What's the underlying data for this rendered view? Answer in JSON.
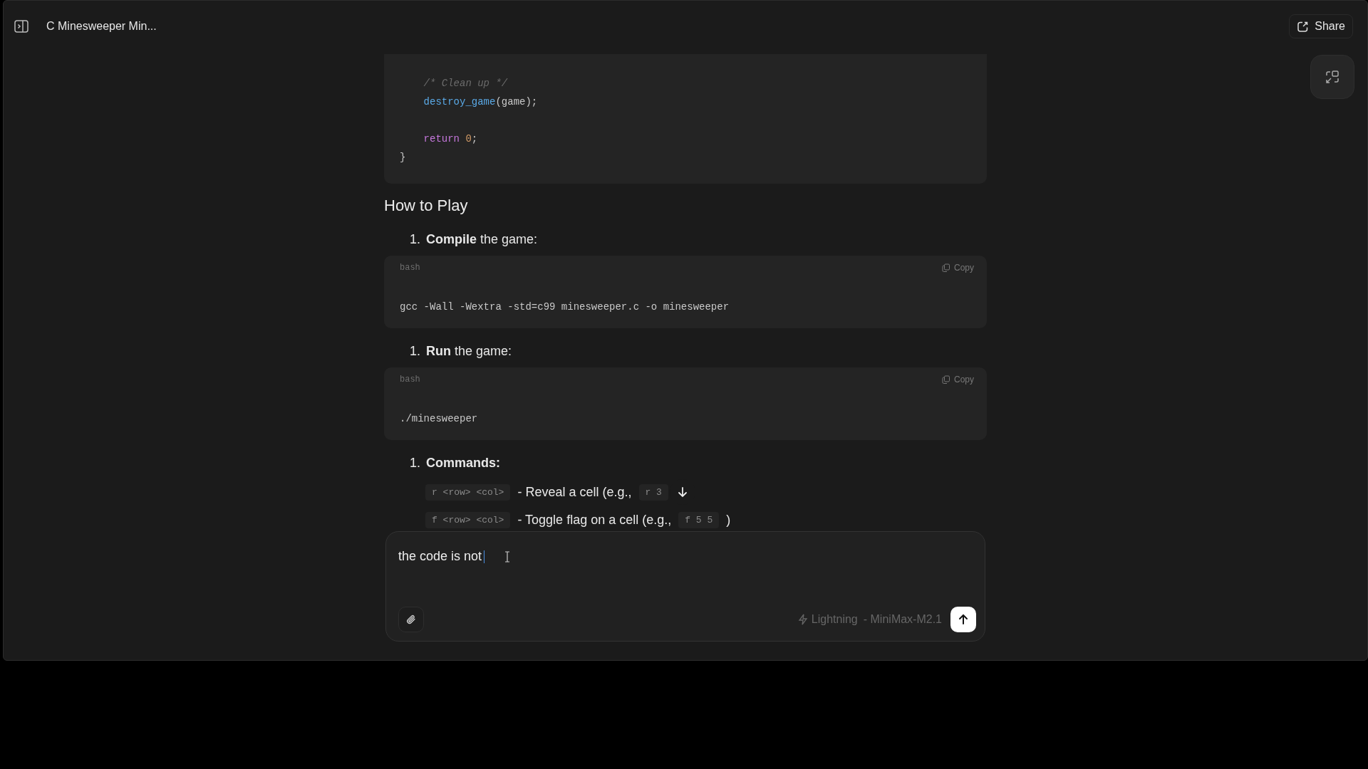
{
  "header": {
    "title": "C Minesweeper Min...",
    "share_label": "Share"
  },
  "code_block": {
    "lines": [
      {
        "kind": "code",
        "tokens": [
          {
            "kind": "comment",
            "text": "    /* Clean up */"
          }
        ]
      },
      {
        "kind": "code",
        "tokens": [
          {
            "kind": "function",
            "text": "    destroy_game"
          },
          {
            "kind": "plain",
            "text": "(game);"
          }
        ]
      },
      {
        "kind": "blank"
      },
      {
        "kind": "code",
        "tokens": [
          {
            "kind": "keyword",
            "text": "    return "
          },
          {
            "kind": "number",
            "text": "0"
          },
          {
            "kind": "plain",
            "text": ";"
          }
        ]
      },
      {
        "kind": "code",
        "tokens": [
          {
            "kind": "plain",
            "text": "}"
          }
        ]
      }
    ]
  },
  "section_heading": "How to Play",
  "steps": [
    {
      "number": "1.",
      "kind": "mixed",
      "text": "**Compile** the game:",
      "snippet": {
        "language": "bash",
        "copy_label": "Copy",
        "code": "gcc -Wall -Wextra -std=c99 minesweeper.c -o minesweeper"
      }
    },
    {
      "number": "1.",
      "kind": "mixed",
      "text": "**Run** the game:",
      "snippet": {
        "language": "bash",
        "copy_label": "Copy",
        "code": "./minesweeper"
      }
    },
    {
      "number": "1.",
      "kind": "bold",
      "text": "Commands:",
      "commands": [
        [
          {
            "kind": "code",
            "text": "r <row> <col>"
          },
          {
            "kind": "text",
            "text": "- Reveal a cell (e.g.,"
          },
          {
            "kind": "code",
            "text": "r 3"
          }
        ],
        [
          {
            "kind": "code",
            "text": "f <row> <col>"
          },
          {
            "kind": "text",
            "text": "- Toggle flag on a cell (e.g.,"
          },
          {
            "kind": "code",
            "text": "f 5 5"
          },
          {
            "kind": "text",
            "text": ")"
          }
        ]
      ]
    }
  ],
  "composer": {
    "value": "the code is not",
    "mode": "Lightning",
    "model": "- MiniMax-M2.1"
  }
}
